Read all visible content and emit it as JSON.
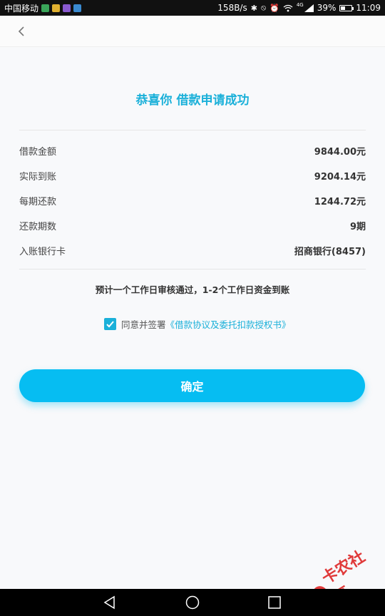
{
  "statusbar": {
    "carrier": "中国移动",
    "network_speed": "158B/s",
    "network_type": "4G",
    "battery": "39%",
    "time": "11:09",
    "icons": [
      "bluetooth-icon",
      "mute-icon",
      "alarm-icon",
      "wifi-icon",
      "signal-icon",
      "battery-icon"
    ]
  },
  "header": {
    "back_icon": "chevron-left-icon"
  },
  "main": {
    "title": "恭喜你 借款申请成功",
    "rows": [
      {
        "label": "借款金额",
        "value": "9844.00元"
      },
      {
        "label": "实际到账",
        "value": "9204.14元"
      },
      {
        "label": "每期还款",
        "value": "1244.72元"
      },
      {
        "label": "还款期数",
        "value": "9期"
      },
      {
        "label": "入账银行卡",
        "value": "招商银行(8457)"
      }
    ],
    "notice": "预计一个工作日审核通过，1-2个工作日资金到账",
    "agreement": {
      "checked": true,
      "prefix": "同意并签署",
      "link": "《借款协议及委托扣款授权书》"
    },
    "confirm_label": "确定"
  },
  "watermark": {
    "text": "卡农社区"
  },
  "colors": {
    "accent": "#1ab0d9",
    "button": "#06bdf2",
    "watermark": "#e03a3a"
  }
}
